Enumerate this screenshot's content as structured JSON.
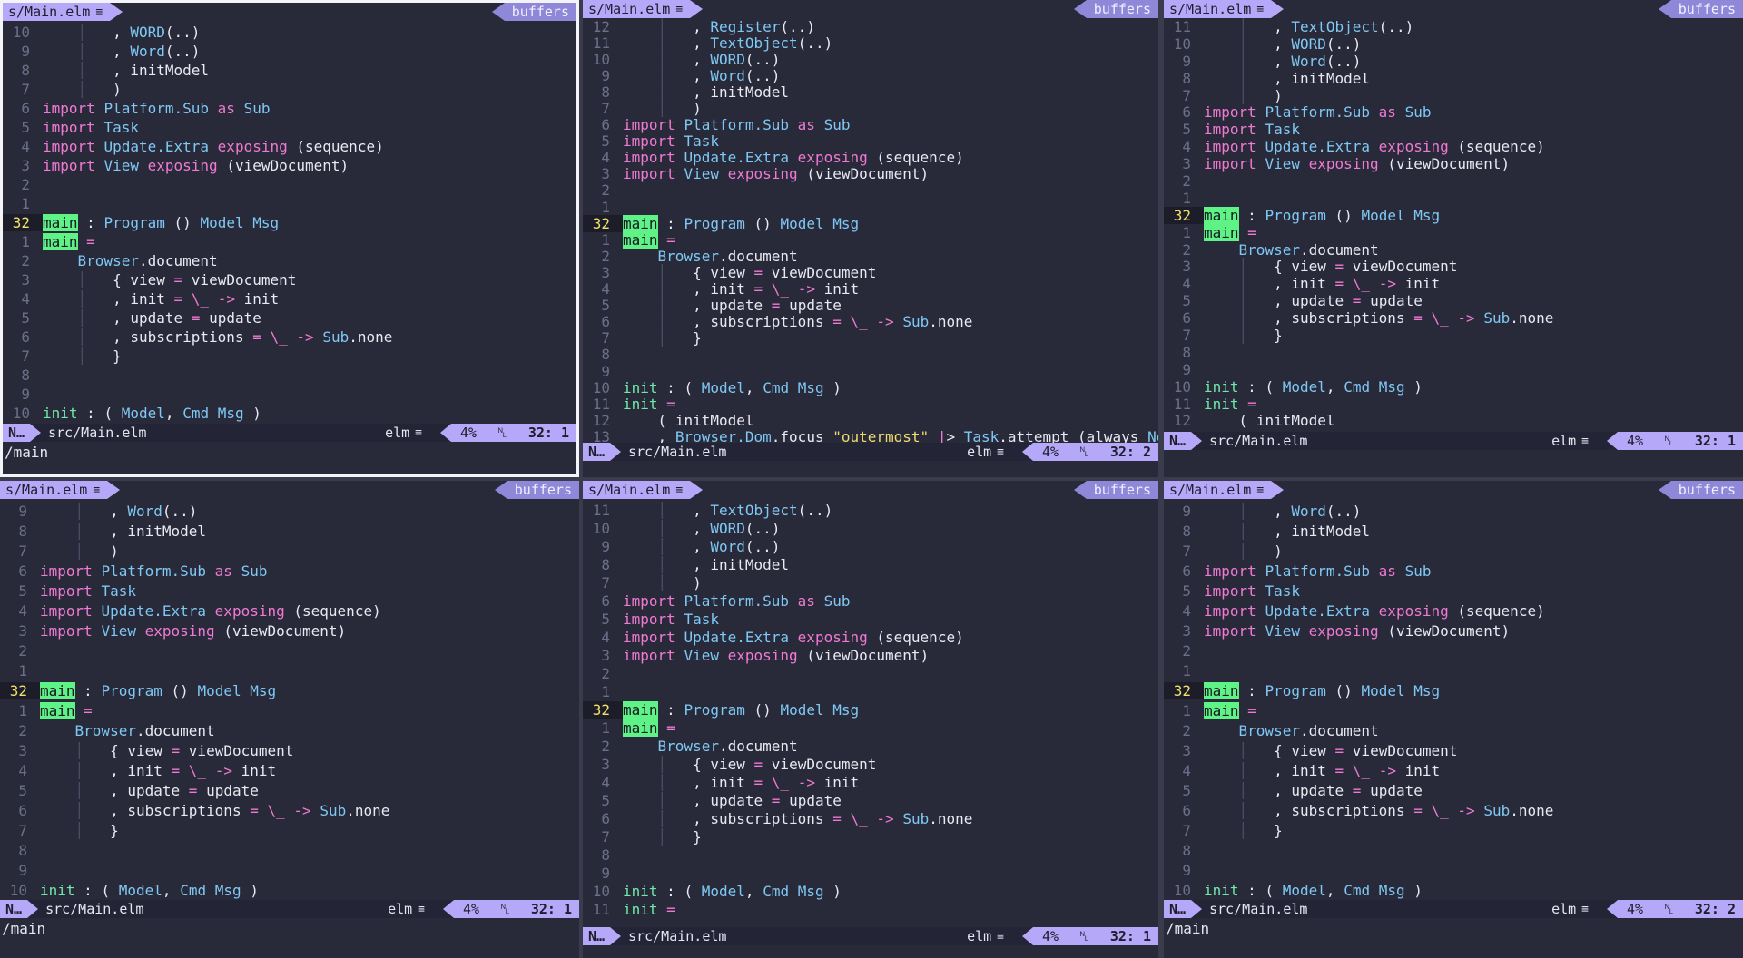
{
  "colors": {
    "accent": "#b6a8f8",
    "keyword": "#f07ad2",
    "type": "#7fc8f3",
    "function": "#72e8a8",
    "string": "#f0dd70",
    "background": "#282a3a",
    "cursorword": "#5ef287"
  },
  "icons": {
    "menu": "menu-lines-icon",
    "modified": "hamburger-icon",
    "scroll": "percent-icon"
  },
  "tab": {
    "filename": "s/Main.elm",
    "buffers_label": "buffers",
    "menu_glyph": "≡"
  },
  "status": {
    "mode": "N…",
    "file": "src/Main.elm",
    "filetype": "elm",
    "percent": "4%",
    "newline": "␤"
  },
  "cmd": {
    "text": "/main"
  },
  "panes": [
    {
      "name": "pane-top-left",
      "cursor": "32:  1"
    },
    {
      "name": "pane-top-middle",
      "cursor": "32:  2"
    },
    {
      "name": "pane-top-right",
      "cursor": "32:  1"
    },
    {
      "name": "pane-bottom-left",
      "cursor": "32:  1"
    },
    {
      "name": "pane-bottom-middle",
      "cursor": "32:  1"
    },
    {
      "name": "pane-bottom-right",
      "cursor": "32:  2"
    }
  ],
  "code_lines": {
    "TL": [
      [
        "10",
        "        , WORD(..)"
      ],
      [
        "9",
        "        , Word(..)"
      ],
      [
        "8",
        "        , initModel"
      ],
      [
        "7",
        "        )"
      ],
      [
        "6",
        "import Platform.Sub as Sub"
      ],
      [
        "5",
        "import Task"
      ],
      [
        "4",
        "import Update.Extra exposing (sequence)"
      ],
      [
        "3",
        "import View exposing (viewDocument)"
      ],
      [
        "2",
        ""
      ],
      [
        "1",
        ""
      ],
      [
        "32",
        "main : Program () Model Msg"
      ],
      [
        "1",
        "main ="
      ],
      [
        "2",
        "    Browser.document"
      ],
      [
        "3",
        "        { view = viewDocument"
      ],
      [
        "4",
        "        , init = \\_ -> init"
      ],
      [
        "5",
        "        , update = update"
      ],
      [
        "6",
        "        , subscriptions = \\_ -> Sub.none"
      ],
      [
        "7",
        "        }"
      ],
      [
        "8",
        ""
      ],
      [
        "9",
        ""
      ],
      [
        "10",
        "init : ( Model, Cmd Msg )"
      ]
    ],
    "TM": [
      [
        "12",
        "        , Register(..)"
      ],
      [
        "11",
        "        , TextObject(..)"
      ],
      [
        "10",
        "        , WORD(..)"
      ],
      [
        "9",
        "        , Word(..)"
      ],
      [
        "8",
        "        , initModel"
      ],
      [
        "7",
        "        )"
      ],
      [
        "6",
        "import Platform.Sub as Sub"
      ],
      [
        "5",
        "import Task"
      ],
      [
        "4",
        "import Update.Extra exposing (sequence)"
      ],
      [
        "3",
        "import View exposing (viewDocument)"
      ],
      [
        "2",
        ""
      ],
      [
        "1",
        ""
      ],
      [
        "32",
        "main : Program () Model Msg"
      ],
      [
        "1",
        "main ="
      ],
      [
        "2",
        "    Browser.document"
      ],
      [
        "3",
        "        { view = viewDocument"
      ],
      [
        "4",
        "        , init = \\_ -> init"
      ],
      [
        "5",
        "        , update = update"
      ],
      [
        "6",
        "        , subscriptions = \\_ -> Sub.none"
      ],
      [
        "7",
        "        }"
      ],
      [
        "8",
        ""
      ],
      [
        "9",
        ""
      ],
      [
        "10",
        "init : ( Model, Cmd Msg )"
      ],
      [
        "11",
        "init ="
      ],
      [
        "12",
        "    ( initModel"
      ],
      [
        "13",
        "    , Browser.Dom.focus \"outermost\" |> Task.attempt (always NoOp)"
      ]
    ],
    "TR": [
      [
        "11",
        "        , TextObject(..)"
      ],
      [
        "10",
        "        , WORD(..)"
      ],
      [
        "9",
        "        , Word(..)"
      ],
      [
        "8",
        "        , initModel"
      ],
      [
        "7",
        "        )"
      ],
      [
        "6",
        "import Platform.Sub as Sub"
      ],
      [
        "5",
        "import Task"
      ],
      [
        "4",
        "import Update.Extra exposing (sequence)"
      ],
      [
        "3",
        "import View exposing (viewDocument)"
      ],
      [
        "2",
        ""
      ],
      [
        "1",
        ""
      ],
      [
        "32",
        "main : Program () Model Msg"
      ],
      [
        "1",
        "main ="
      ],
      [
        "2",
        "    Browser.document"
      ],
      [
        "3",
        "        { view = viewDocument"
      ],
      [
        "4",
        "        , init = \\_ -> init"
      ],
      [
        "5",
        "        , update = update"
      ],
      [
        "6",
        "        , subscriptions = \\_ -> Sub.none"
      ],
      [
        "7",
        "        }"
      ],
      [
        "8",
        ""
      ],
      [
        "9",
        ""
      ],
      [
        "10",
        "init : ( Model, Cmd Msg )"
      ],
      [
        "11",
        "init ="
      ],
      [
        "12",
        "    ( initModel"
      ]
    ],
    "BL": [
      [
        "9",
        "        , Word(..)"
      ],
      [
        "8",
        "        , initModel"
      ],
      [
        "7",
        "        )"
      ],
      [
        "6",
        "import Platform.Sub as Sub"
      ],
      [
        "5",
        "import Task"
      ],
      [
        "4",
        "import Update.Extra exposing (sequence)"
      ],
      [
        "3",
        "import View exposing (viewDocument)"
      ],
      [
        "2",
        ""
      ],
      [
        "1",
        ""
      ],
      [
        "32",
        "main : Program () Model Msg"
      ],
      [
        "1",
        "main ="
      ],
      [
        "2",
        "    Browser.document"
      ],
      [
        "3",
        "        { view = viewDocument"
      ],
      [
        "4",
        "        , init = \\_ -> init"
      ],
      [
        "5",
        "        , update = update"
      ],
      [
        "6",
        "        , subscriptions = \\_ -> Sub.none"
      ],
      [
        "7",
        "        }"
      ],
      [
        "8",
        ""
      ],
      [
        "9",
        ""
      ],
      [
        "10",
        "init : ( Model, Cmd Msg )"
      ]
    ],
    "BM": [
      [
        "11",
        "        , TextObject(..)"
      ],
      [
        "10",
        "        , WORD(..)"
      ],
      [
        "9",
        "        , Word(..)"
      ],
      [
        "8",
        "        , initModel"
      ],
      [
        "7",
        "        )"
      ],
      [
        "6",
        "import Platform.Sub as Sub"
      ],
      [
        "5",
        "import Task"
      ],
      [
        "4",
        "import Update.Extra exposing (sequence)"
      ],
      [
        "3",
        "import View exposing (viewDocument)"
      ],
      [
        "2",
        ""
      ],
      [
        "1",
        ""
      ],
      [
        "32",
        "main : Program () Model Msg"
      ],
      [
        "1",
        "main ="
      ],
      [
        "2",
        "    Browser.document"
      ],
      [
        "3",
        "        { view = viewDocument"
      ],
      [
        "4",
        "        , init = \\_ -> init"
      ],
      [
        "5",
        "        , update = update"
      ],
      [
        "6",
        "        , subscriptions = \\_ -> Sub.none"
      ],
      [
        "7",
        "        }"
      ],
      [
        "8",
        ""
      ],
      [
        "9",
        ""
      ],
      [
        "10",
        "init : ( Model, Cmd Msg )"
      ],
      [
        "11",
        "init ="
      ]
    ],
    "BR": [
      [
        "9",
        "        , Word(..)"
      ],
      [
        "8",
        "        , initModel"
      ],
      [
        "7",
        "        )"
      ],
      [
        "6",
        "import Platform.Sub as Sub"
      ],
      [
        "5",
        "import Task"
      ],
      [
        "4",
        "import Update.Extra exposing (sequence)"
      ],
      [
        "3",
        "import View exposing (viewDocument)"
      ],
      [
        "2",
        ""
      ],
      [
        "1",
        ""
      ],
      [
        "32",
        "main : Program () Model Msg"
      ],
      [
        "1",
        "main ="
      ],
      [
        "2",
        "    Browser.document"
      ],
      [
        "3",
        "        { view = viewDocument"
      ],
      [
        "4",
        "        , init = \\_ -> init"
      ],
      [
        "5",
        "        , update = update"
      ],
      [
        "6",
        "        , subscriptions = \\_ -> Sub.none"
      ],
      [
        "7",
        "        }"
      ],
      [
        "8",
        ""
      ],
      [
        "9",
        ""
      ],
      [
        "10",
        "init : ( Model, Cmd Msg )"
      ]
    ]
  }
}
